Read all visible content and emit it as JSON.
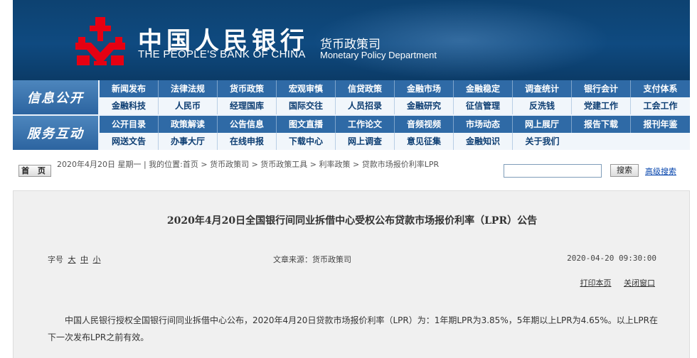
{
  "header": {
    "logo_cn": "中国人民银行",
    "logo_en": "THE PEOPLE'S BANK OF CHINA",
    "dept_cn": "货币政策司",
    "dept_en": "Monetary Policy Department"
  },
  "nav": {
    "group1": {
      "title": "信息公开",
      "row1": [
        "新闻发布",
        "法律法规",
        "货币政策",
        "宏观审慎",
        "信贷政策",
        "金融市场",
        "金融稳定",
        "调查统计",
        "银行会计",
        "支付体系"
      ],
      "row2": [
        "金融科技",
        "人民币",
        "经理国库",
        "国际交往",
        "人员招录",
        "金融研究",
        "征信管理",
        "反洗钱",
        "党建工作",
        "工会工作"
      ]
    },
    "group2": {
      "title": "服务互动",
      "row1": [
        "公开目录",
        "政策解读",
        "公告信息",
        "图文直播",
        "工作论文",
        "音频视频",
        "市场动态",
        "网上展厅",
        "报告下载",
        "报刊年鉴"
      ],
      "row2": [
        "网送文告",
        "办事大厅",
        "在线申报",
        "下载中心",
        "网上调查",
        "意见征集",
        "金融知识",
        "关于我们"
      ]
    }
  },
  "crumbbar": {
    "home_label": "首 页",
    "date_text": "2020年4月20日 星期一 | 我的位置:首页 > 货币政策司 > 货币政策工具 > 利率政策 > 贷款市场报价利率LPR",
    "search_value": "",
    "search_button": "搜索",
    "advanced_search": "高级搜索"
  },
  "article": {
    "title": "2020年4月20日全国银行间同业拆借中心受权公布贷款市场报价利率（LPR）公告",
    "font_size_label": "字号",
    "font_sizes": [
      "大",
      "中",
      "小"
    ],
    "source": "文章来源：货币政策司",
    "datetime": "2020-04-20 09:30:00",
    "print_label": "打印本页",
    "close_label": "关闭窗口",
    "body": "中国人民银行授权全国银行间同业拆借中心公布，2020年4月20日贷款市场报价利率（LPR）为：1年期LPR为3.85%，5年期以上LPR为4.65%。以上LPR在下一次发布LPR之前有效。"
  },
  "colors": {
    "header_bg": "#0f4a80",
    "logo_red": "#e60012",
    "nav_dark": "#2f6aa6",
    "nav_light": "#f1f6fb",
    "article_bg": "#f0f0f0"
  }
}
